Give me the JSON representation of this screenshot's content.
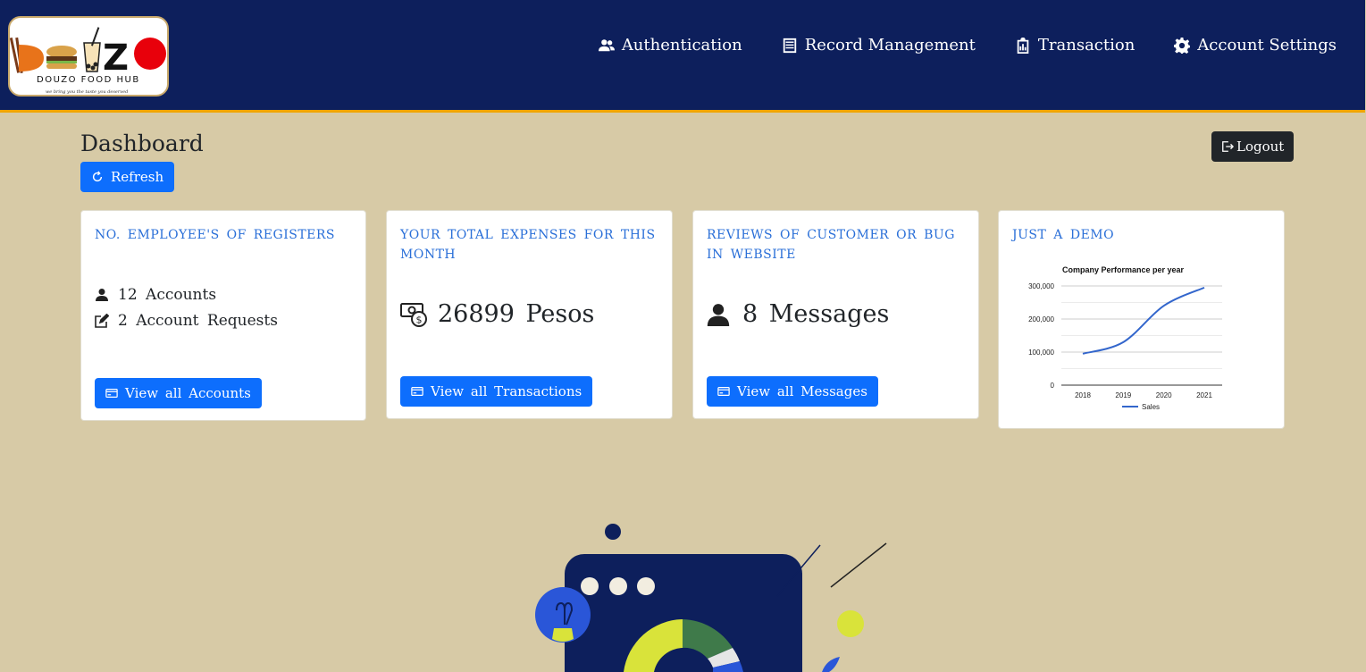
{
  "brand": {
    "name": "DOUZO FOOD HUB",
    "tagline": "we bring you the taste you deserved",
    "logo_letters": "DOUZO"
  },
  "nav": {
    "items": [
      {
        "label": "Authentication",
        "icon": "users-icon"
      },
      {
        "label": "Record Management",
        "icon": "records-icon"
      },
      {
        "label": "Transaction",
        "icon": "clipboard-icon"
      },
      {
        "label": "Account Settings",
        "icon": "gear-icon"
      }
    ]
  },
  "header": {
    "title": "Dashboard",
    "refresh_label": "Refresh",
    "logout_label": "Logout"
  },
  "cards": {
    "employees": {
      "title": "NO. EMPLOYEE'S OF REGISTERS",
      "accounts": "12  Accounts",
      "requests": "2  Account Requests",
      "button": "View  all  Accounts"
    },
    "expenses": {
      "title": "YOUR TOTAL EXPENSES FOR THIS MONTH",
      "amount": "26899  Pesos",
      "button": "View  all  Transactions"
    },
    "reviews": {
      "title": "REVIEWS OF CUSTOMER OR BUG IN WEBSITE",
      "count": "8  Messages",
      "button": "View  all  Messages"
    },
    "demo": {
      "title": "JUST A DEMO"
    }
  },
  "chart_data": {
    "type": "line",
    "title": "Company Performance per year",
    "categories": [
      "2018",
      "2019",
      "2020",
      "2021"
    ],
    "series": [
      {
        "name": "Sales",
        "values": [
          95000,
          130000,
          240000,
          295000
        ],
        "color": "#3366cc"
      }
    ],
    "ylim": [
      0,
      300000
    ],
    "yticks": [
      "0",
      "100,000",
      "200,000",
      "300,000"
    ],
    "legend": "bottom",
    "grid": true
  },
  "colors": {
    "navbar": "#0d1f5c",
    "accent_border": "#f0a500",
    "background": "#d7caa6",
    "primary": "#0d6efd",
    "title_blue": "#2a6fd8"
  }
}
